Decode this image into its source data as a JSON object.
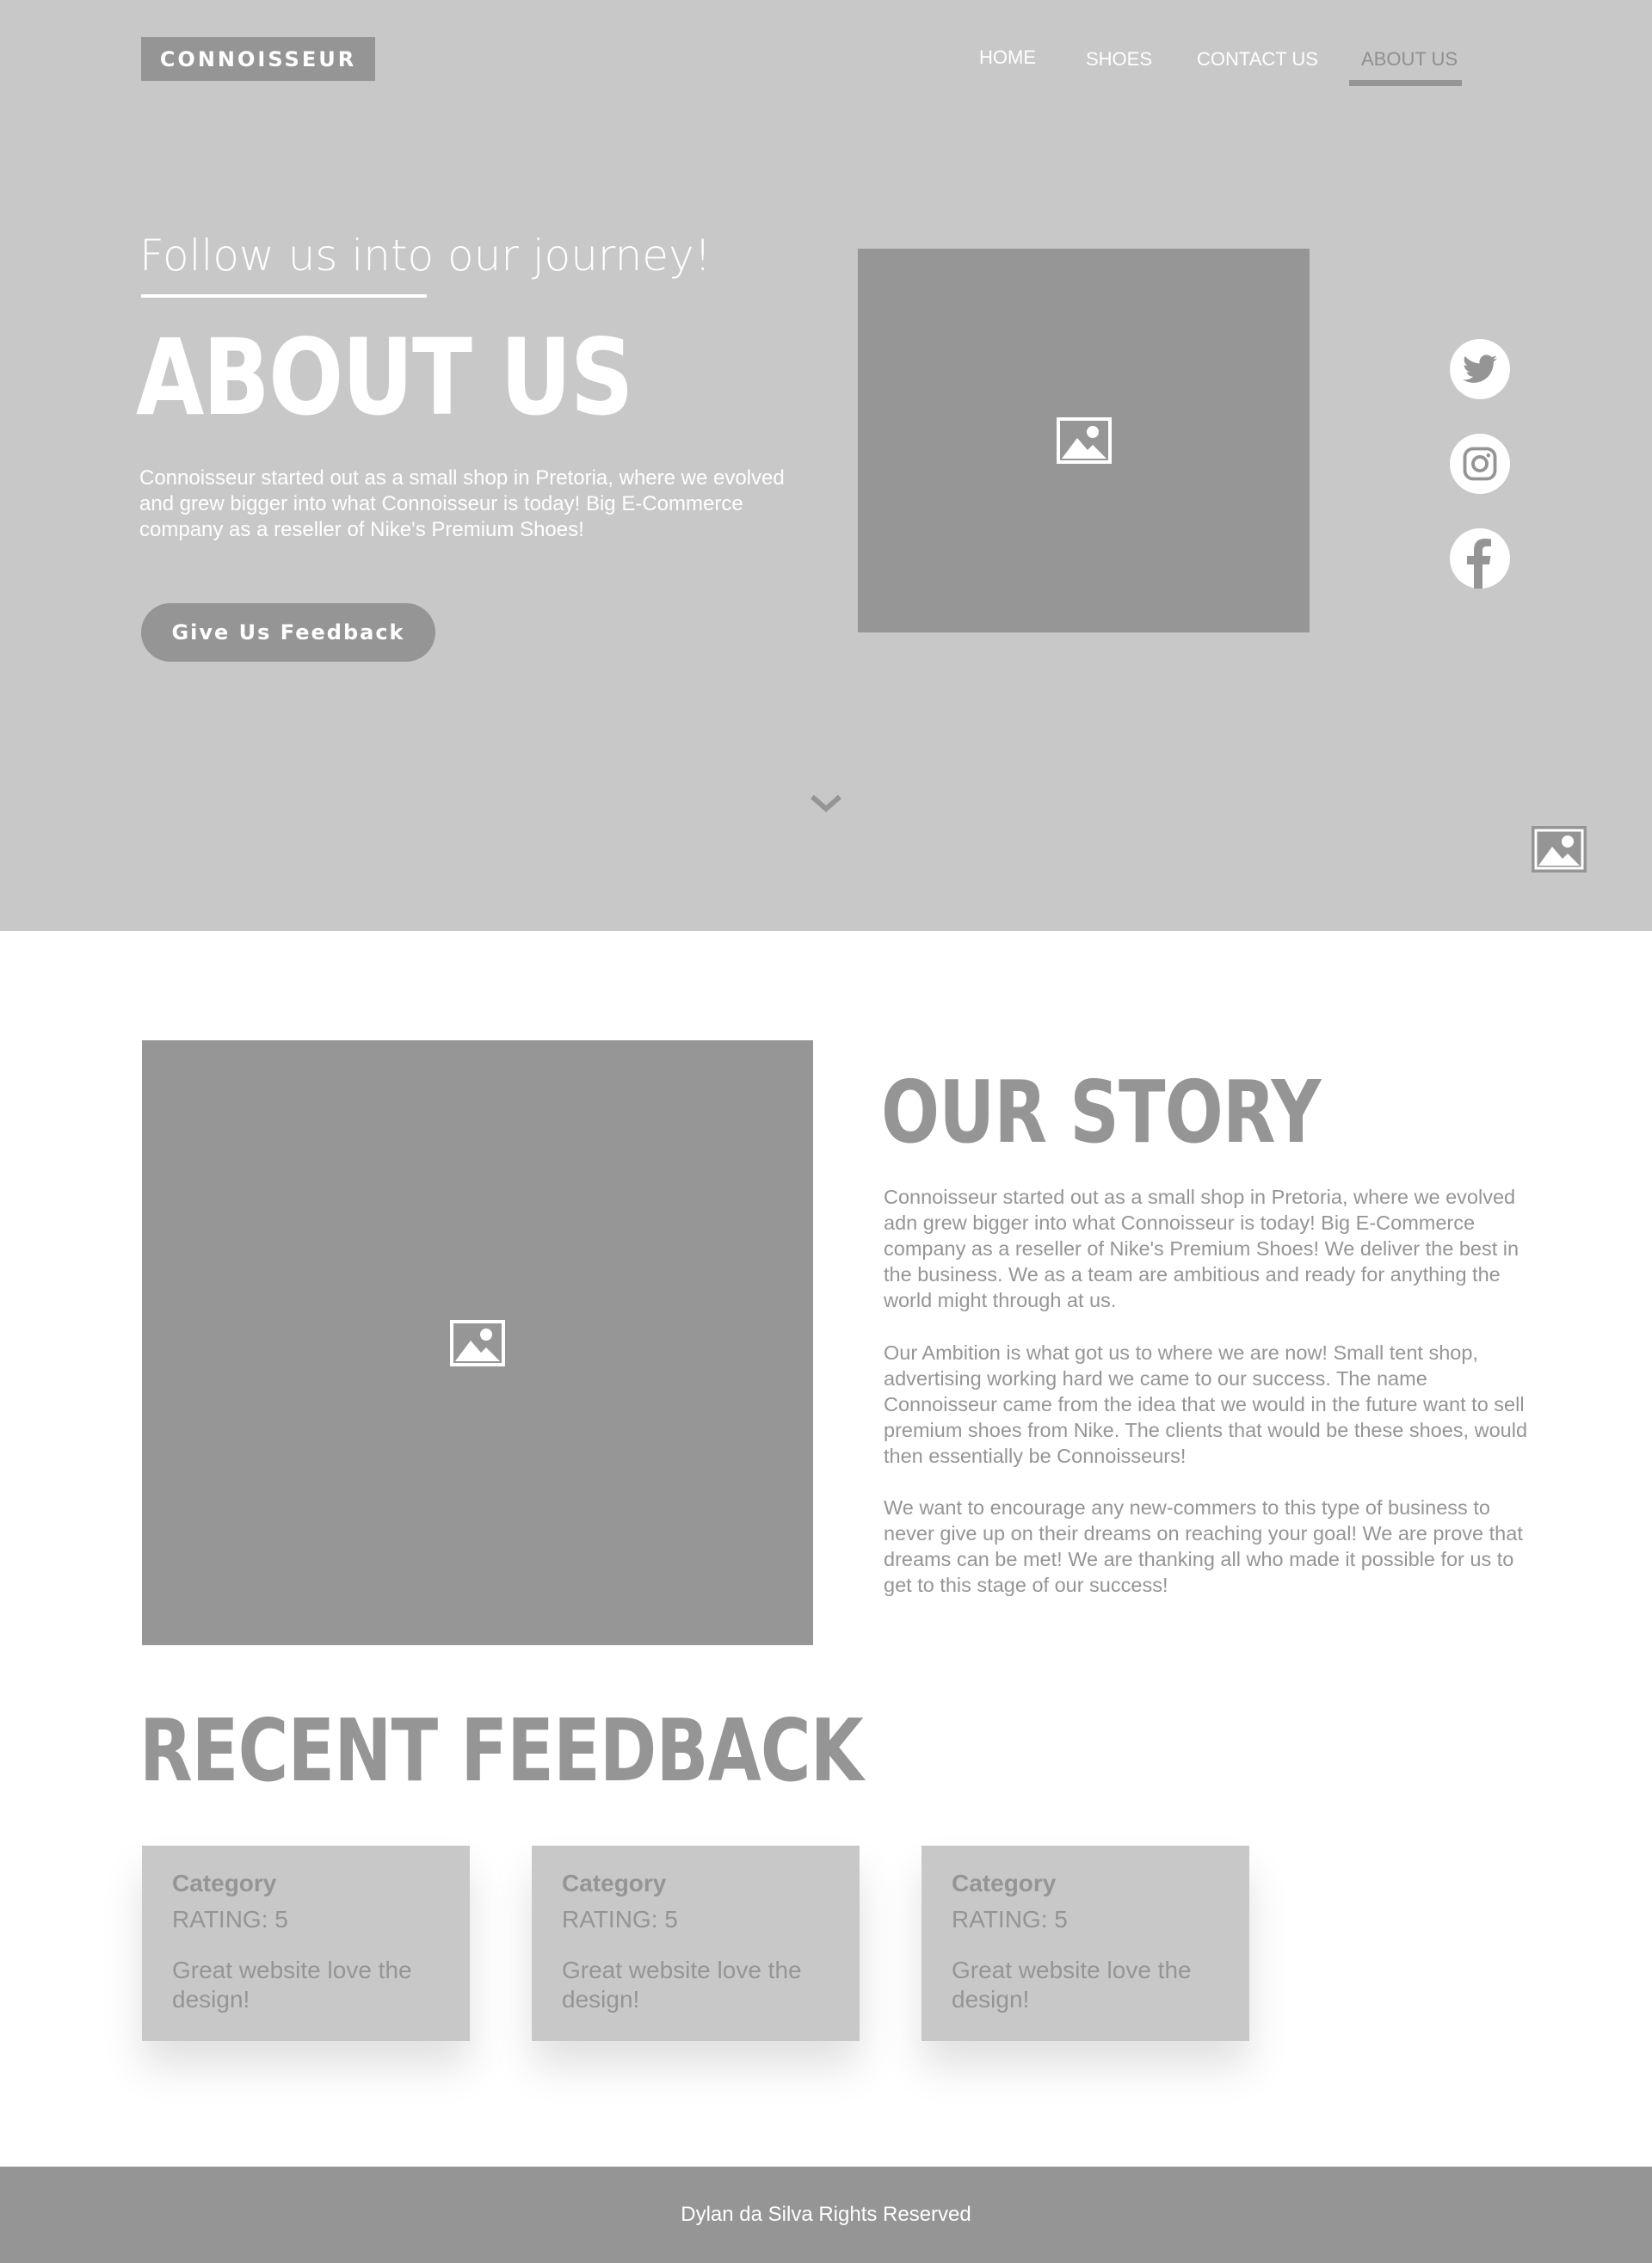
{
  "header": {
    "logo": "CONNOISSEUR",
    "nav": [
      {
        "label": "HOME",
        "active": false
      },
      {
        "label": "SHOES",
        "active": false
      },
      {
        "label": "CONTACT US",
        "active": false
      },
      {
        "label": "ABOUT US",
        "active": true
      }
    ]
  },
  "hero": {
    "tagline": "Follow us into our journey!",
    "title": "ABOUT US",
    "text": "Connoisseur started out as a small shop in Pretoria, where we evolved and grew bigger into what Connoisseur is today! Big E-Commerce company as a reseller of Nike's Premium Shoes!",
    "button": "Give Us Feedback",
    "social": [
      "twitter-icon",
      "instagram-icon",
      "facebook-icon"
    ]
  },
  "story": {
    "title": "OUR STORY",
    "paragraphs": [
      "Connoisseur started out as a small shop in Pretoria, where we evolved adn grew bigger into what Connoisseur is today! Big E-Commerce company as a reseller of Nike's Premium Shoes! We deliver the best in the business. We as a team are ambitious and ready for anything the world might through at us.",
      "Our Ambition is what got us to where we are now! Small tent shop, advertising working hard we came to our success. The name Connoisseur came from the idea that we would in the future want to sell premium shoes from Nike. The clients that would be these shoes, would then essentially be Connoisseurs!",
      "We want to encourage any new-commers to this type of business to never give up on their dreams on reaching your goal! We are prove that dreams can be met! We are thanking all who made it possible for us to get to this stage of our success!"
    ]
  },
  "feedback": {
    "title": "RECENT FEEDBACK",
    "cards": [
      {
        "category": "Category",
        "rating": "RATING: 5",
        "text": "Great website love the design!"
      },
      {
        "category": "Category",
        "rating": "RATING: 5",
        "text": "Great website love the design!"
      },
      {
        "category": "Category",
        "rating": "RATING: 5",
        "text": "Great website love the design!"
      }
    ]
  },
  "footer": {
    "text": "Dylan da Silva Rights Reserved"
  },
  "colors": {
    "hero_bg": "#c9c8c9",
    "accent_gray": "#959595",
    "placeholder": "#969696",
    "white": "#ffffff"
  }
}
